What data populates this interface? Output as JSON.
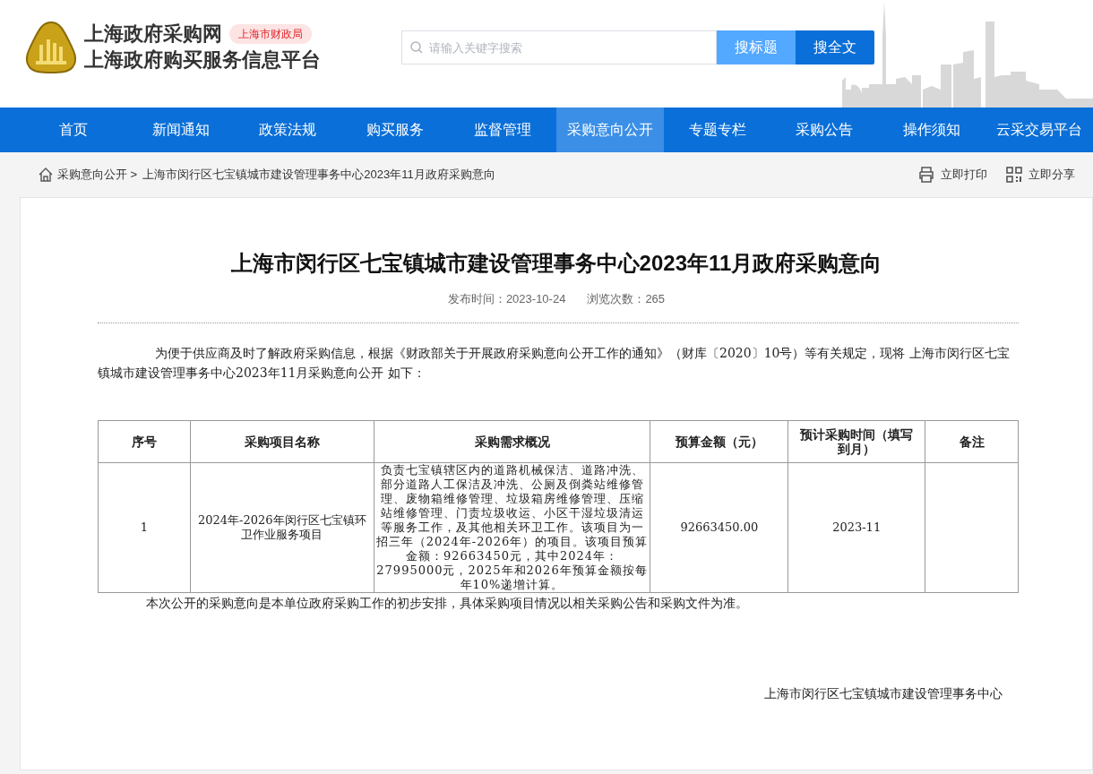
{
  "header": {
    "site_name": "上海政府采购网",
    "badge": "上海市财政局",
    "subtitle": "上海政府购买服务信息平台",
    "search": {
      "placeholder": "请输入关键字搜索"
    },
    "search_buttons": [
      {
        "label": "搜标题",
        "kind": "light"
      },
      {
        "label": "搜全文",
        "kind": "dark"
      }
    ]
  },
  "nav": [
    {
      "label": "首页",
      "selected": false
    },
    {
      "label": "新闻通知",
      "selected": false
    },
    {
      "label": "政策法规",
      "selected": false
    },
    {
      "label": "购买服务",
      "selected": false
    },
    {
      "label": "监督管理",
      "selected": false
    },
    {
      "label": "采购意向公开",
      "selected": true
    },
    {
      "label": "专题专栏",
      "selected": false
    },
    {
      "label": "采购公告",
      "selected": false
    },
    {
      "label": "操作须知",
      "selected": false
    },
    {
      "label": "云采交易平台",
      "selected": false
    }
  ],
  "breadcrumb": {
    "items": [
      "采购意向公开 >",
      "上海市闵行区七宝镇城市建设管理事务中心2023年11月政府采购意向"
    ],
    "actions": [
      {
        "label": "立即打印",
        "kind": "print"
      },
      {
        "label": "立即分享",
        "kind": "share"
      }
    ]
  },
  "article": {
    "title": "上海市闵行区七宝镇城市建设管理事务中心2023年11月政府采购意向",
    "publish_time": "发布时间：2023-10-24",
    "views": "浏览次数：265",
    "intro": "为便于供应商及时了解政府采购信息，根据《财政部关于开展政府采购意向公开工作的通知》（财库〔2020〕10号）等有关规定，现将 上海市闵行区七宝镇城市建设管理事务中心2023年11月采购意向公开 如下：",
    "table": {
      "columns": [
        "序号",
        "采购项目名称",
        "采购需求概况",
        "预算金额（元）",
        "预计采购时间（填写到月）",
        "备注"
      ],
      "rows": [
        [
          "1",
          "2024年-2026年闵行区七宝镇环卫作业服务项目",
          "负责七宝镇辖区内的道路机械保洁、道路冲洗、部分道路人工保洁及冲洗、公厕及倒粪站维修管理、废物箱维修管理、垃圾箱房维修管理、压缩站维修管理、门责垃圾收运、小区干湿垃圾清运等服务工作，及其他相关环卫工作。该项目为一招三年（2024年-2026年）的项目。该项目预算金额：92663450元，其中2024年：27995000元，2025年和2026年预算金额按每年10%递增计算。",
          "92663450.00",
          "2023-11",
          ""
        ]
      ]
    },
    "closing": "本次公开的采购意向是本单位政府采购工作的初步安排，具体采购项目情况以相关采购公告和采购文件为准。",
    "signature": "上海市闵行区七宝镇城市建设管理事务中心"
  }
}
